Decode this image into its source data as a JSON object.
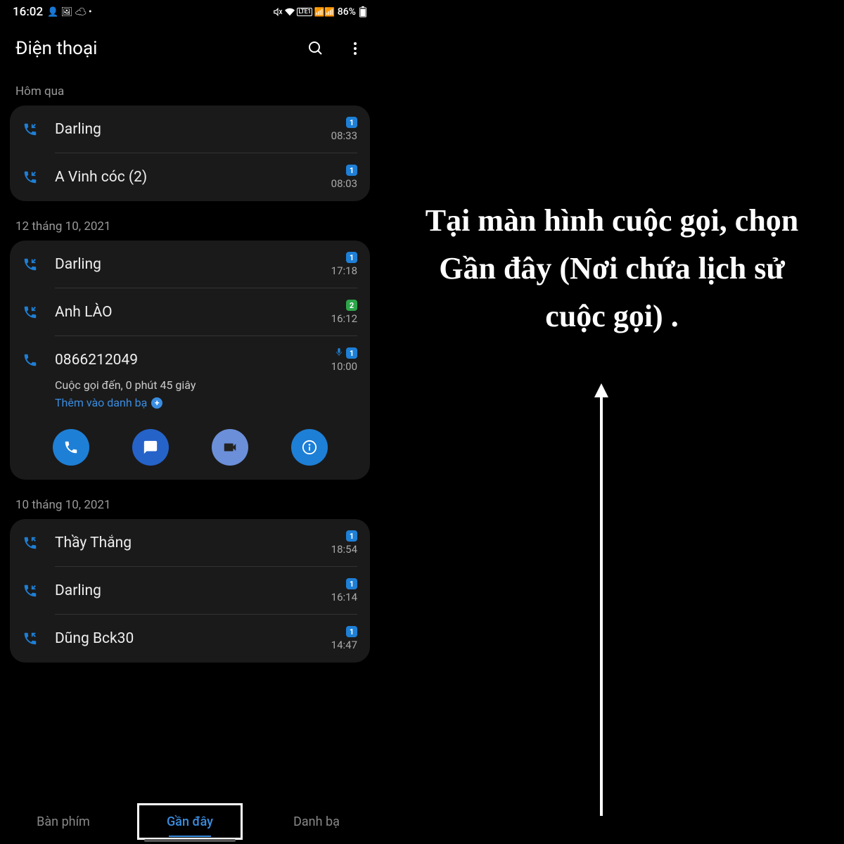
{
  "status": {
    "time": "16:02",
    "battery": "86%",
    "network": "LTE1"
  },
  "header": {
    "title": "Điện thoại"
  },
  "sections": [
    {
      "label": "Hôm qua",
      "calls": [
        {
          "name": "Darling",
          "time": "08:33",
          "direction": "incoming",
          "sim": "1"
        },
        {
          "name": "A Vinh cóc (2)",
          "time": "08:03",
          "direction": "incoming",
          "sim": "1"
        }
      ]
    },
    {
      "label": "12 tháng 10, 2021",
      "calls": [
        {
          "name": "Darling",
          "time": "17:18",
          "direction": "incoming",
          "sim": "1"
        },
        {
          "name": "Anh LÀO",
          "time": "16:12",
          "direction": "incoming",
          "sim": "2"
        },
        {
          "name": "0866212049",
          "time": "10:00",
          "direction": "incoming",
          "sim": "1",
          "recorded": true,
          "expanded": {
            "detail": "Cuộc gọi đến, 0 phút 45 giây",
            "add": "Thêm vào danh bạ"
          }
        }
      ]
    },
    {
      "label": "10 tháng 10, 2021",
      "calls": [
        {
          "name": "Thầy Thắng",
          "time": "18:54",
          "direction": "outgoing",
          "sim": "1"
        },
        {
          "name": "Darling",
          "time": "16:14",
          "direction": "incoming",
          "sim": "1"
        },
        {
          "name": "Dũng Bck30",
          "time": "14:47",
          "direction": "outgoing",
          "sim": "1"
        }
      ]
    }
  ],
  "tabs": {
    "keypad": "Bàn phím",
    "recent": "Gần đây",
    "contacts": "Danh bạ"
  },
  "annotation": "Tại màn hình cuộc gọi, chọn Gần đây (Nơi chứa lịch sử cuộc gọi) ."
}
